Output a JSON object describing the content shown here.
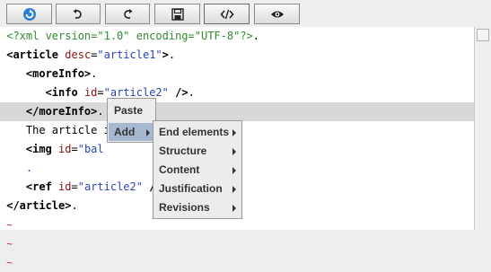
{
  "toolbar": {
    "buttons": [
      {
        "name": "refresh-icon"
      },
      {
        "name": "undo-icon"
      },
      {
        "name": "redo-icon"
      },
      {
        "name": "save-icon"
      },
      {
        "name": "source-code-icon"
      },
      {
        "name": "eye-icon"
      }
    ]
  },
  "editor": {
    "lines": [
      {
        "indent": "",
        "parts": [
          {
            "t": "<?xml version=\"1.0\" encoding=\"UTF-8\"?>",
            "c": "pi"
          },
          {
            "t": ".",
            "c": ""
          }
        ]
      },
      {
        "indent": "",
        "parts": [
          {
            "t": "<article",
            "c": "tag"
          },
          {
            "t": " ",
            "c": ""
          },
          {
            "t": "desc",
            "c": "attr"
          },
          {
            "t": "=",
            "c": ""
          },
          {
            "t": "\"article1\"",
            "c": "val"
          },
          {
            "t": ">",
            "c": "tag"
          },
          {
            "t": ".",
            "c": ""
          }
        ]
      },
      {
        "indent": "   ",
        "parts": [
          {
            "t": "<moreInfo>",
            "c": "tag"
          },
          {
            "t": ".",
            "c": ""
          }
        ]
      },
      {
        "indent": "      ",
        "parts": [
          {
            "t": "<info",
            "c": "tag"
          },
          {
            "t": " ",
            "c": ""
          },
          {
            "t": "id",
            "c": "attr"
          },
          {
            "t": "=",
            "c": ""
          },
          {
            "t": "\"article2\"",
            "c": "val"
          },
          {
            "t": " />",
            "c": "tag"
          },
          {
            "t": ".",
            "c": ""
          }
        ]
      },
      {
        "indent": "   ",
        "parts": [
          {
            "t": "</moreInfo>",
            "c": "tag"
          },
          {
            "t": ".",
            "c": ""
          }
        ]
      },
      {
        "indent": "   ",
        "parts": [
          {
            "t": "The article i",
            "c": ""
          }
        ]
      },
      {
        "indent": "   ",
        "parts": [
          {
            "t": "<img",
            "c": "tag"
          },
          {
            "t": " ",
            "c": ""
          },
          {
            "t": "id",
            "c": "attr"
          },
          {
            "t": "=",
            "c": ""
          },
          {
            "t": "\"bal",
            "c": "val"
          }
        ]
      },
      {
        "indent": "   ",
        "parts": [
          {
            "t": ".",
            "c": "val"
          }
        ]
      },
      {
        "indent": "   ",
        "parts": [
          {
            "t": "<ref",
            "c": "tag"
          },
          {
            "t": " ",
            "c": ""
          },
          {
            "t": "id",
            "c": "attr"
          },
          {
            "t": "=",
            "c": ""
          },
          {
            "t": "\"article2\"",
            "c": "val"
          },
          {
            "t": " /",
            "c": "tag"
          }
        ]
      },
      {
        "indent": "",
        "parts": [
          {
            "t": "</article>",
            "c": "tag"
          },
          {
            "t": ".",
            "c": ""
          }
        ]
      },
      {
        "indent": "",
        "parts": [
          {
            "t": "~",
            "c": "tilde"
          }
        ]
      },
      {
        "indent": "",
        "parts": [
          {
            "t": "~",
            "c": "tilde"
          }
        ]
      },
      {
        "indent": "",
        "parts": [
          {
            "t": "~",
            "c": "tilde"
          }
        ]
      }
    ],
    "highlighted_line": 4
  },
  "context_menu": {
    "items": [
      "Paste",
      "Add"
    ],
    "selected": "Add"
  },
  "submenu": {
    "items": [
      "End elements",
      "Structure",
      "Content",
      "Justification",
      "Revisions"
    ]
  }
}
